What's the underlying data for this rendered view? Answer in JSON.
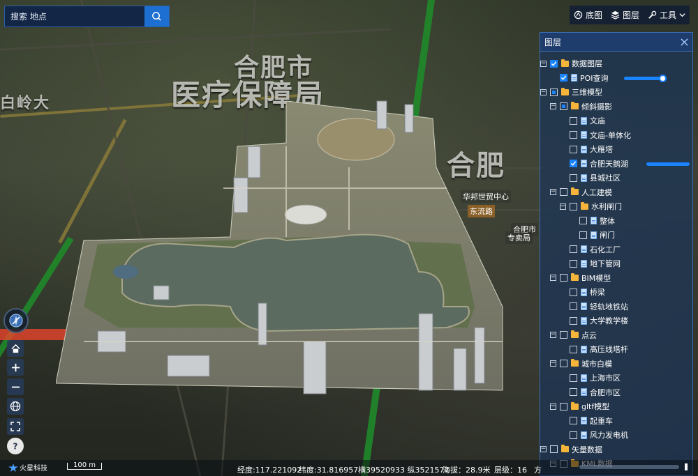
{
  "search": {
    "placeholder": "搜索 地点"
  },
  "toolbar": {
    "basemap_label": "底图",
    "layers_label": "图层",
    "tools_label": "工具"
  },
  "map_labels": {
    "large_1": "合肥市",
    "large_2": "医疗保障局",
    "left": "白岭大",
    "right": "合肥",
    "poi_1": "华邦世贸中心",
    "poi_2": "东流路",
    "poi_3": "合肥市",
    "poi_4": "专卖局"
  },
  "layer_panel": {
    "title": "图层",
    "nodes": [
      {
        "label": "数据图层",
        "type": "folder",
        "checked": "on",
        "expanded": true
      },
      {
        "label": "POI查询",
        "type": "file",
        "checked": "on",
        "slider": 0.9
      },
      {
        "label": "三维模型",
        "type": "folder",
        "checked": "half",
        "expanded": true
      },
      {
        "label": "倾斜摄影",
        "type": "folder",
        "checked": "half",
        "expanded": true
      },
      {
        "label": "文庙",
        "type": "file",
        "checked": "off"
      },
      {
        "label": "文庙-单体化",
        "type": "file",
        "checked": "off"
      },
      {
        "label": "大雁塔",
        "type": "file",
        "checked": "off"
      },
      {
        "label": "合肥天鹅湖",
        "type": "file",
        "checked": "on",
        "slider": 1.0
      },
      {
        "label": "县城社区",
        "type": "file",
        "checked": "off"
      },
      {
        "label": "人工建模",
        "type": "folder",
        "checked": "off",
        "expanded": true
      },
      {
        "label": "水利闸门",
        "type": "folder",
        "checked": "off",
        "expanded": true
      },
      {
        "label": "整体",
        "type": "file",
        "checked": "off"
      },
      {
        "label": "闸门",
        "type": "file",
        "checked": "off"
      },
      {
        "label": "石化工厂",
        "type": "file",
        "checked": "off"
      },
      {
        "label": "地下管网",
        "type": "file",
        "checked": "off"
      },
      {
        "label": "BIM模型",
        "type": "folder",
        "checked": "off",
        "expanded": true
      },
      {
        "label": "桥梁",
        "type": "file",
        "checked": "off"
      },
      {
        "label": "轻轨地铁站",
        "type": "file",
        "checked": "off"
      },
      {
        "label": "大学教学楼",
        "type": "file",
        "checked": "off"
      },
      {
        "label": "点云",
        "type": "folder",
        "checked": "off",
        "expanded": true
      },
      {
        "label": "高压线塔杆",
        "type": "file",
        "checked": "off"
      },
      {
        "label": "城市白模",
        "type": "folder",
        "checked": "off",
        "expanded": true
      },
      {
        "label": "上海市区",
        "type": "file",
        "checked": "off"
      },
      {
        "label": "合肥市区",
        "type": "file",
        "checked": "off"
      },
      {
        "label": "gltf模型",
        "type": "folder",
        "checked": "off",
        "expanded": true
      },
      {
        "label": "起重车",
        "type": "file",
        "checked": "off"
      },
      {
        "label": "风力发电机",
        "type": "file",
        "checked": "off"
      },
      {
        "label": "矢量数据",
        "type": "folder",
        "checked": "off",
        "expanded": true
      },
      {
        "label": "KML数据",
        "type": "folder",
        "checked": "off",
        "expanded": true
      }
    ]
  },
  "status": {
    "brand": "火星科技",
    "scale": "100 m",
    "longitude": "经度:117.221092",
    "latitude": "纬度:31.816957",
    "mercator": "横39520933 纵3521577",
    "altitude": "海拔：28.9米",
    "level": "层级：16",
    "direction": "方"
  },
  "colors": {
    "accent": "#1a84ff",
    "panel_bg": "#1c3458",
    "folder": "#f5b43a",
    "search_button": "#1e6fd2"
  },
  "icons": [
    "search-icon",
    "basemap-icon",
    "layers-icon",
    "tools-icon",
    "chevron-down-icon",
    "close-icon",
    "compass-icon",
    "home-icon",
    "zoom-in-icon",
    "zoom-out-icon",
    "globe-icon",
    "fullscreen-icon",
    "help-icon",
    "folder-icon",
    "file-icon"
  ]
}
